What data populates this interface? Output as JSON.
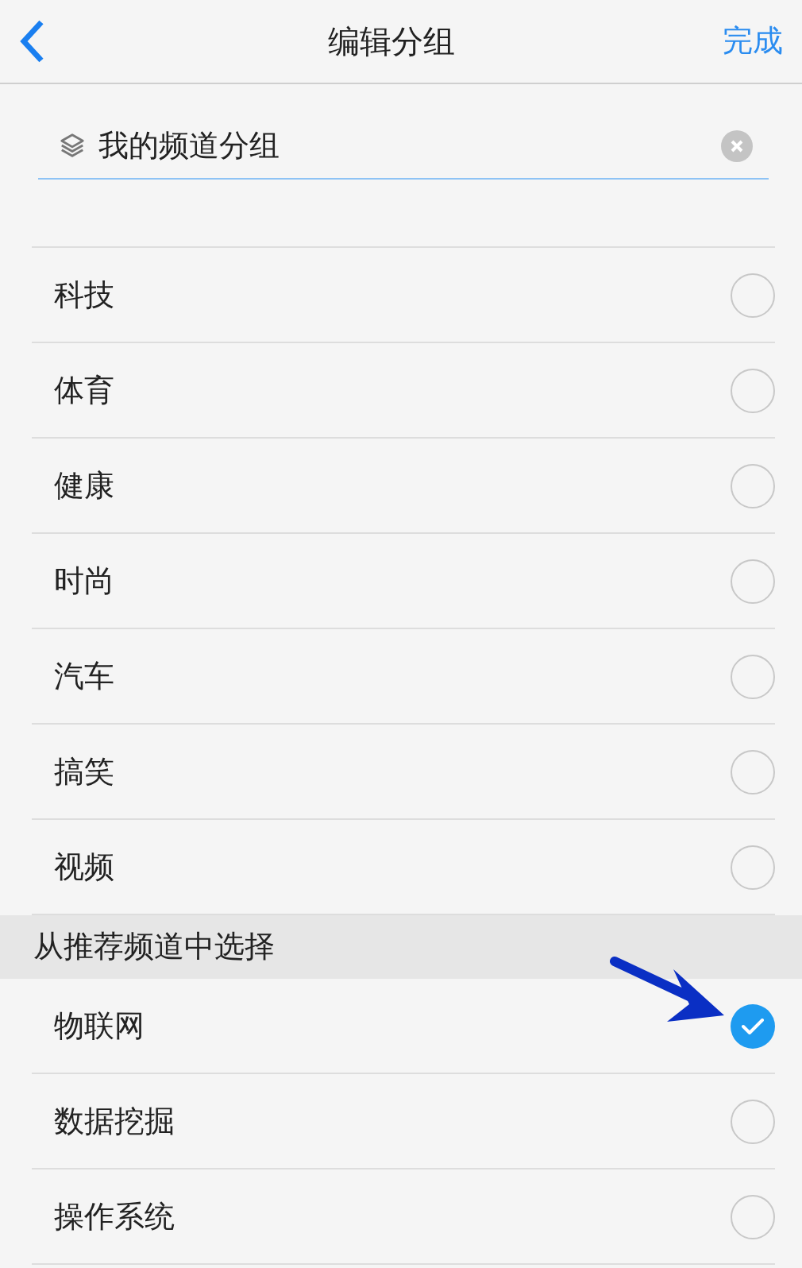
{
  "nav": {
    "title": "编辑分组",
    "done": "完成"
  },
  "group_field": {
    "value": "我的频道分组"
  },
  "my_channels": [
    {
      "label": "科技",
      "selected": false
    },
    {
      "label": "体育",
      "selected": false
    },
    {
      "label": "健康",
      "selected": false
    },
    {
      "label": "时尚",
      "selected": false
    },
    {
      "label": "汽车",
      "selected": false
    },
    {
      "label": "搞笑",
      "selected": false
    },
    {
      "label": "视频",
      "selected": false
    }
  ],
  "recommended": {
    "header": "从推荐频道中选择",
    "items": [
      {
        "label": "物联网",
        "selected": true
      },
      {
        "label": "数据挖掘",
        "selected": false
      },
      {
        "label": "操作系统",
        "selected": false
      }
    ]
  }
}
